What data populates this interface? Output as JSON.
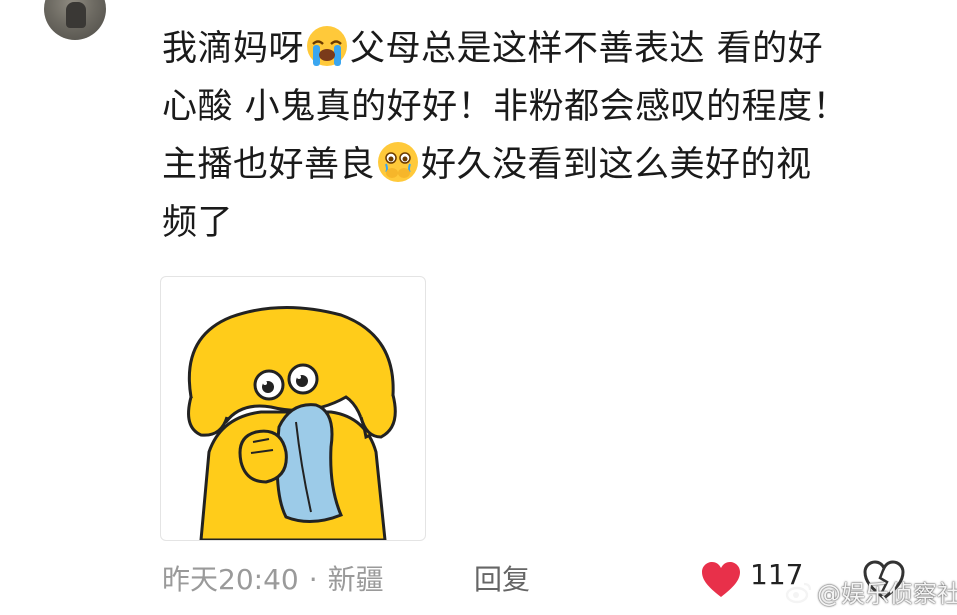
{
  "comment": {
    "line1_a": "我滴妈呀",
    "line1_b": "父母总是这样不善表达 看的好",
    "line2": "心酸 小鬼真的好好！非粉都会感叹的程度！",
    "line3_a": "主播也好善良",
    "line3_b": "好久没看到这么美好的视",
    "line4": "频了",
    "emoji_1": "loudly-crying-emoji",
    "emoji_2": "holding-back-tears-emoji"
  },
  "sticker": {
    "icon": "yellow-character-crying-into-towel-sticker"
  },
  "meta": {
    "time": "昨天20:40",
    "separator": "·",
    "location": "新疆",
    "reply_label": "回复"
  },
  "actions": {
    "like_icon": "heart-icon",
    "like_count": "117",
    "like_color": "#e8304a",
    "dislike_icon": "broken-heart-icon"
  },
  "watermark": {
    "icon": "weibo-logo",
    "text": "@娱乐侦察社"
  }
}
